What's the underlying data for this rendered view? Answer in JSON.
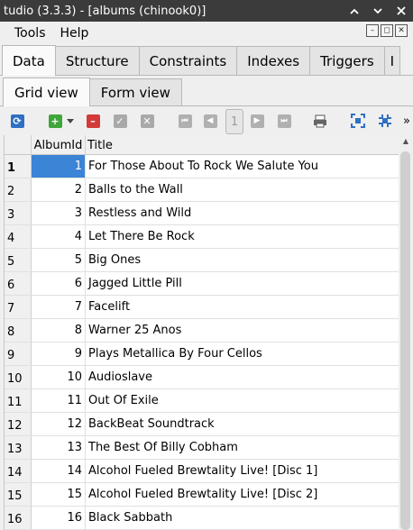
{
  "window": {
    "title": "tudio (3.3.3) - [albums (chinook0)]"
  },
  "menu": {
    "tools": "Tools",
    "help": "Help"
  },
  "tabs": [
    {
      "label": "Data",
      "active": true
    },
    {
      "label": "Structure"
    },
    {
      "label": "Constraints"
    },
    {
      "label": "Indexes"
    },
    {
      "label": "Triggers"
    },
    {
      "label": "I"
    }
  ],
  "subtabs": [
    {
      "label": "Grid view",
      "active": true
    },
    {
      "label": "Form view"
    }
  ],
  "toolbar": {
    "page_number": "1",
    "more": "»"
  },
  "grid": {
    "columns": [
      "AlbumId",
      "Title"
    ],
    "rows": [
      {
        "n": "1",
        "id": "1",
        "title": "For Those About To Rock We Salute You"
      },
      {
        "n": "2",
        "id": "2",
        "title": "Balls to the Wall"
      },
      {
        "n": "3",
        "id": "3",
        "title": "Restless and Wild"
      },
      {
        "n": "4",
        "id": "4",
        "title": "Let There Be Rock"
      },
      {
        "n": "5",
        "id": "5",
        "title": "Big Ones"
      },
      {
        "n": "6",
        "id": "6",
        "title": "Jagged Little Pill"
      },
      {
        "n": "7",
        "id": "7",
        "title": "Facelift"
      },
      {
        "n": "8",
        "id": "8",
        "title": "Warner 25 Anos"
      },
      {
        "n": "9",
        "id": "9",
        "title": "Plays Metallica By Four Cellos"
      },
      {
        "n": "10",
        "id": "10",
        "title": "Audioslave"
      },
      {
        "n": "11",
        "id": "11",
        "title": "Out Of Exile"
      },
      {
        "n": "12",
        "id": "12",
        "title": "BackBeat Soundtrack"
      },
      {
        "n": "13",
        "id": "13",
        "title": "The Best Of Billy Cobham"
      },
      {
        "n": "14",
        "id": "14",
        "title": "Alcohol Fueled Brewtality Live! [Disc 1]"
      },
      {
        "n": "15",
        "id": "15",
        "title": "Alcohol Fueled Brewtality Live! [Disc 2]"
      },
      {
        "n": "16",
        "id": "16",
        "title": "Black Sabbath"
      }
    ]
  },
  "colors": {
    "selection": "#3b84d6",
    "titlebar": "#3b3b3b"
  }
}
